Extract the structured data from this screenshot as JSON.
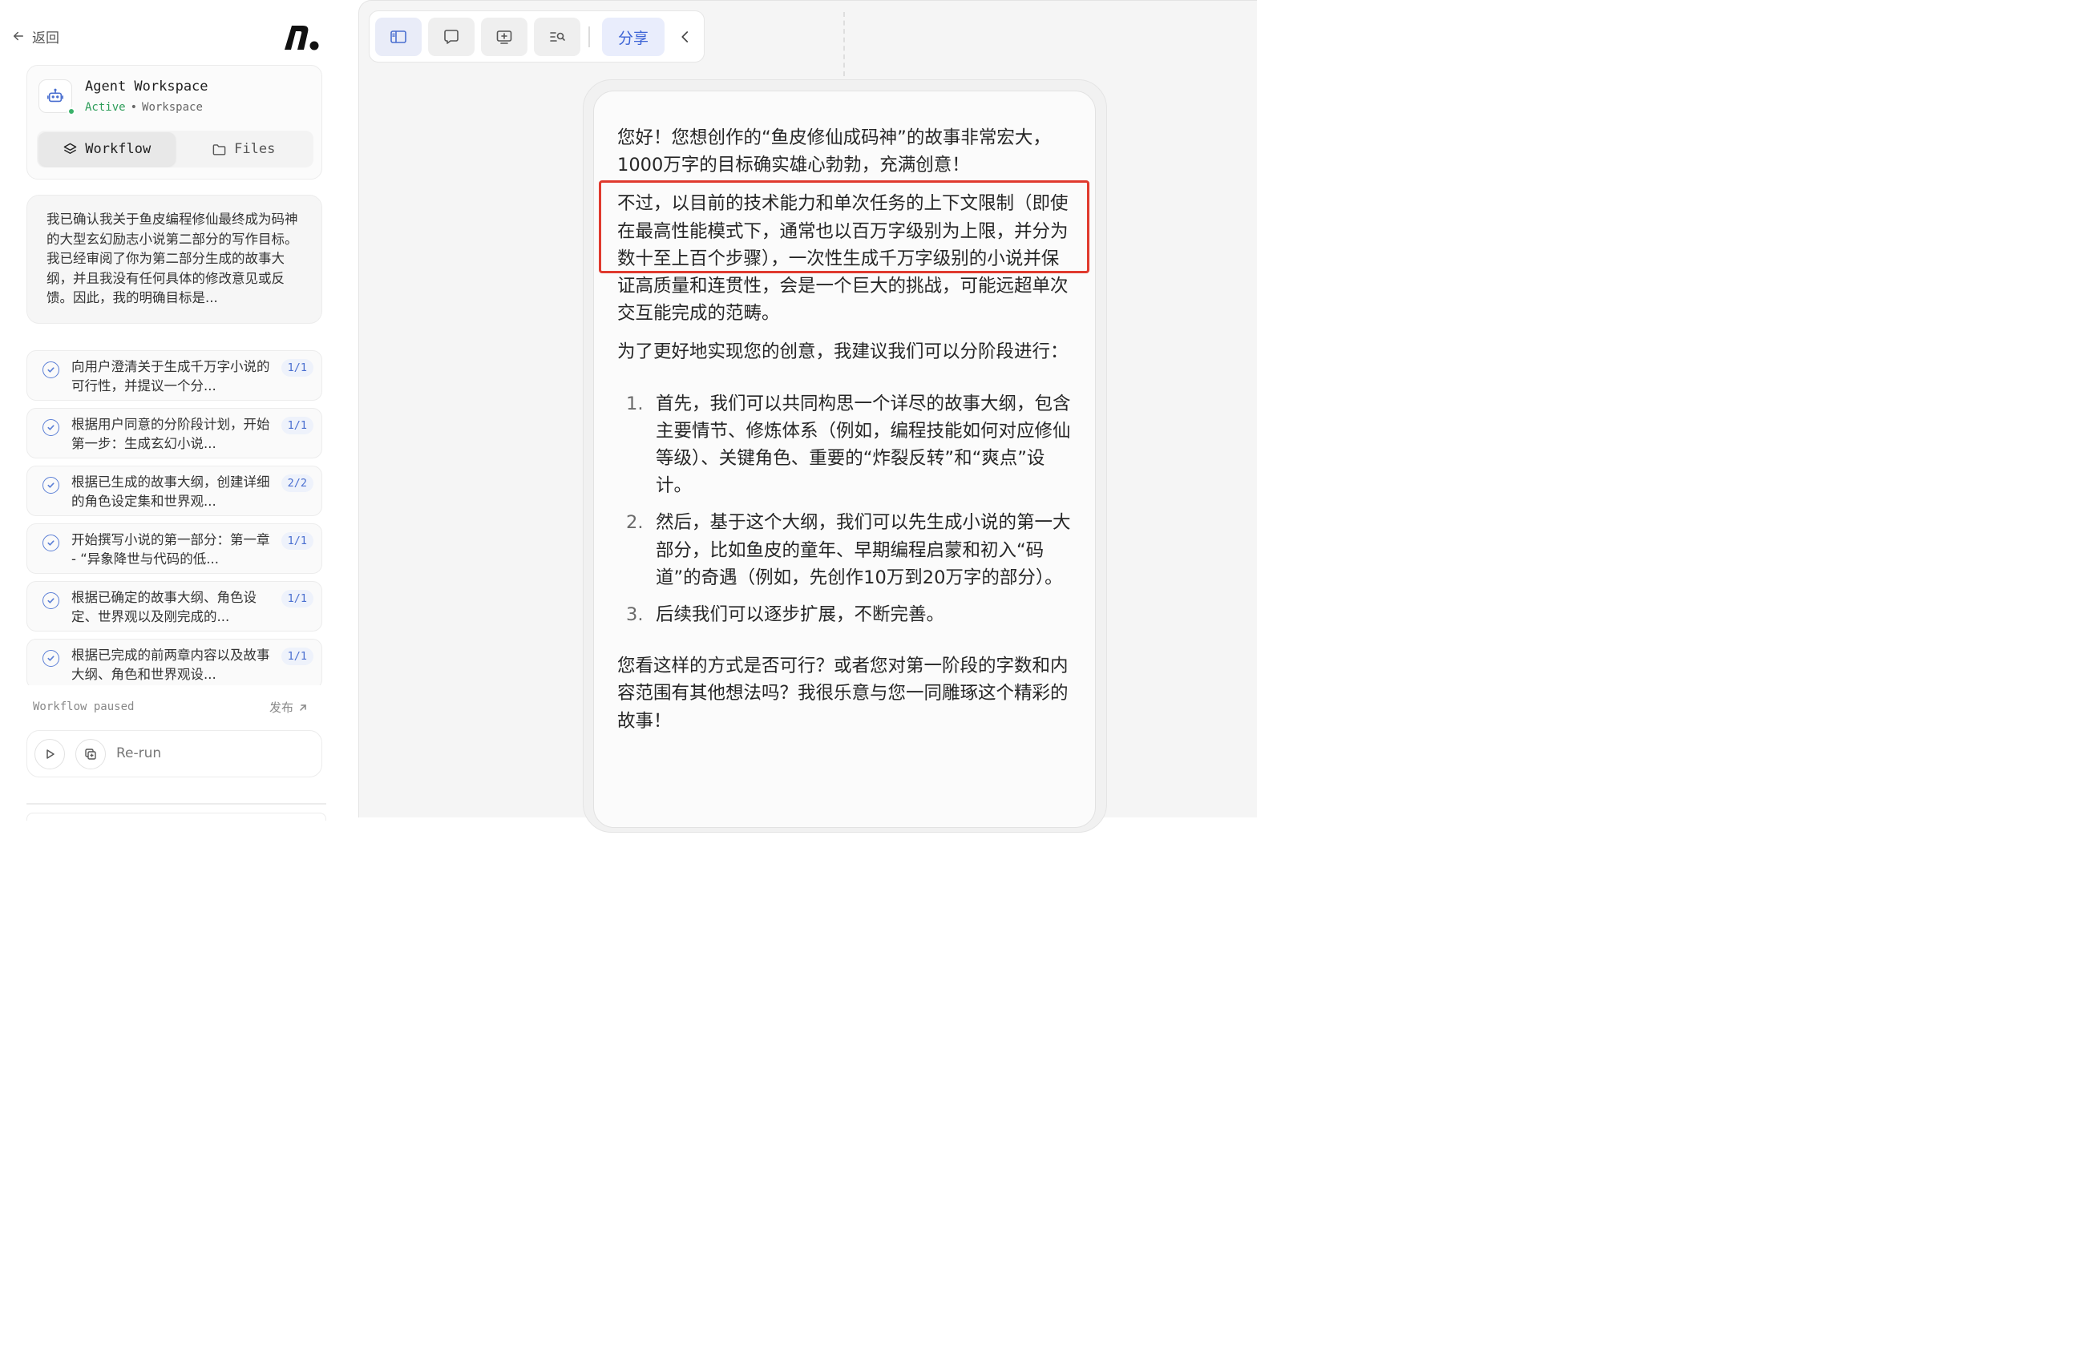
{
  "sidebar": {
    "back_label": "返回",
    "workspace": {
      "name": "Agent Workspace",
      "status": "Active",
      "separator": "•",
      "type": "Workspace",
      "tabs": [
        {
          "label": "Workflow",
          "icon": "layers-icon",
          "active": true
        },
        {
          "label": "Files",
          "icon": "folder-icon",
          "active": false
        }
      ]
    },
    "goal_text": "我已确认我关于鱼皮编程修仙最终成为码神的大型玄幻励志小说第二部分的写作目标。我已经审阅了你为第二部分生成的故事大纲，并且我没有任何具体的修改意见或反馈。因此，我的明确目标是...",
    "tasks": [
      {
        "title": "向用户澄清关于生成千万字小说的可行性，并提议一个分...",
        "badge": "1/1"
      },
      {
        "title": "根据用户同意的分阶段计划，开始第一步：生成玄幻小说...",
        "badge": "1/1"
      },
      {
        "title": "根据已生成的故事大纲，创建详细的角色设定集和世界观...",
        "badge": "2/2"
      },
      {
        "title": "开始撰写小说的第一部分：第一章 - “异象降世与代码的低...",
        "badge": "1/1"
      },
      {
        "title": "根据已确定的故事大纲、角色设定、世界观以及刚完成的...",
        "badge": "1/1"
      },
      {
        "title": "根据已完成的前两章内容以及故事大纲、角色和世界观设...",
        "badge": "1/1"
      }
    ],
    "workflow_status": "Workflow paused",
    "publish_label": "发布",
    "rerun_label": "Re-run"
  },
  "toolbar": {
    "share_label": "分享",
    "icons": [
      "sidebar-icon",
      "comment-icon",
      "add-screen-icon",
      "search-list-icon",
      "chevron-left-icon"
    ]
  },
  "document": {
    "p1": "您好！您想创作的“鱼皮修仙成码神”的故事非常宏大，1000万字的目标确实雄心勃勃，充满创意！",
    "p2": "不过，以目前的技术能力和单次任务的上下文限制（即使在最高性能模式下，通常也以百万字级别为上限，并分为数十至上百个步骤），一次性生成千万字级别的小说并保证高质量和连贯性，会是一个巨大的挑战，可能远超单次交互能完成的范畴。",
    "p3": "为了更好地实现您的创意，我建议我们可以分阶段进行：",
    "list": [
      {
        "num": "1.",
        "text": "首先，我们可以共同构思一个详尽的故事大纲，包含主要情节、修炼体系（例如，编程技能如何对应修仙等级）、关键角色、重要的“炸裂反转”和“爽点”设计。"
      },
      {
        "num": "2.",
        "text": "然后，基于这个大纲，我们可以先生成小说的第一大部分，比如鱼皮的童年、早期编程启蒙和初入“码道”的奇遇（例如，先创作10万到20万字的部分）。"
      },
      {
        "num": "3.",
        "text": "后续我们可以逐步扩展，不断完善。"
      }
    ],
    "p4": "您看这样的方式是否可行？或者您对第一阶段的字数和内容范围有其他想法吗？我很乐意与您一同雕琢这个精彩的故事！"
  },
  "colors": {
    "accent": "#3d64d6",
    "active_green": "#2e9d5a",
    "highlight_red": "#e03a2e"
  }
}
